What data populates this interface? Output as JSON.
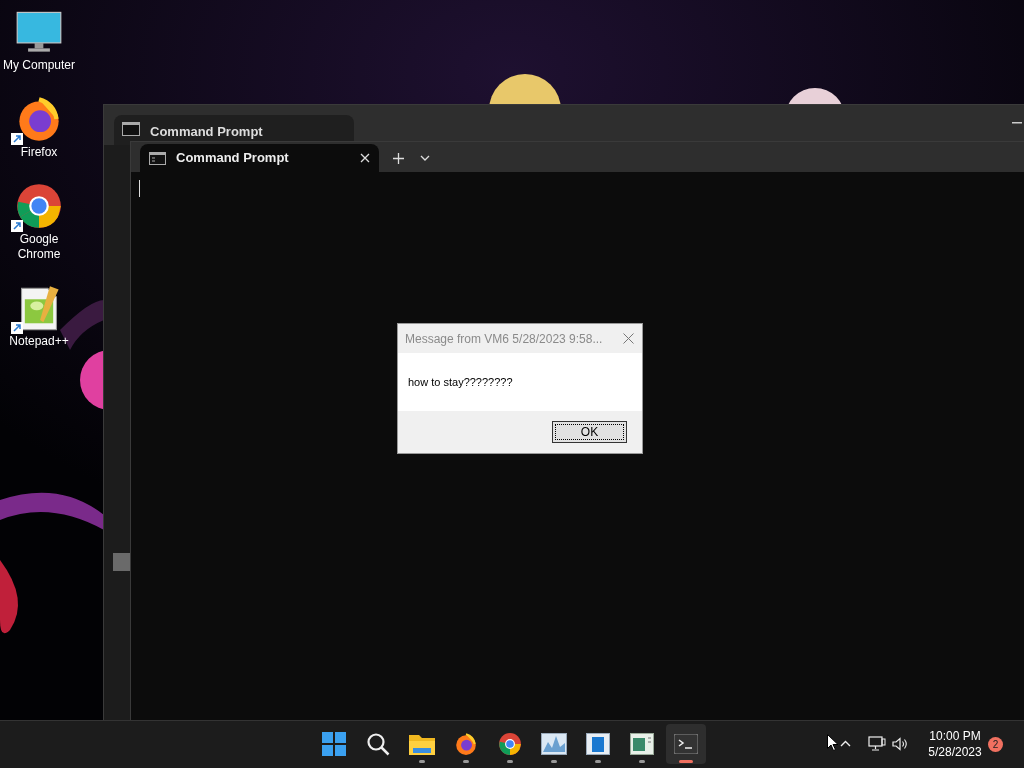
{
  "desktop_icons": [
    {
      "label": "My Computer",
      "kind": "computer",
      "shortcut": false
    },
    {
      "label": "Firefox",
      "kind": "firefox",
      "shortcut": true
    },
    {
      "label": "Google Chrome",
      "kind": "chrome",
      "shortcut": true
    },
    {
      "label": "Notepad++",
      "kind": "notepad",
      "shortcut": true
    }
  ],
  "back_window": {
    "tab_title": "Command Prompt"
  },
  "front_window": {
    "tab_title": "Command Prompt"
  },
  "dialog": {
    "title": "Message from VM6 5/28/2023 9:58...",
    "message": "how to stay????????",
    "button": "OK"
  },
  "taskbar": {
    "apps": [
      {
        "kind": "start",
        "running": false,
        "selected": false
      },
      {
        "kind": "search",
        "running": false,
        "selected": false
      },
      {
        "kind": "explorer",
        "running": true,
        "selected": false
      },
      {
        "kind": "firefox",
        "running": true,
        "selected": false
      },
      {
        "kind": "chrome",
        "running": true,
        "selected": false
      },
      {
        "kind": "monitor",
        "running": true,
        "selected": false
      },
      {
        "kind": "window",
        "running": true,
        "selected": false
      },
      {
        "kind": "editor",
        "running": true,
        "selected": false
      },
      {
        "kind": "terminal",
        "running": true,
        "selected": true
      }
    ],
    "time": "10:00 PM",
    "date": "5/28/2023",
    "notification_count": "2"
  }
}
